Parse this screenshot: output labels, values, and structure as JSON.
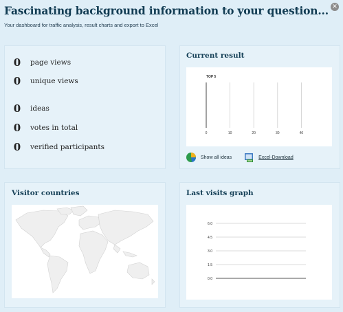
{
  "header": {
    "title": "Fascinating background information to your question...",
    "subtitle": "Your dashboard for traffic analysis, result charts and export to Excel",
    "close_icon": "close-icon"
  },
  "stats": {
    "items": [
      {
        "value": "0",
        "label": "page views"
      },
      {
        "value": "0",
        "label": "unique views"
      },
      {
        "value": "0",
        "label": "ideas"
      },
      {
        "value": "0",
        "label": "votes in total"
      },
      {
        "value": "0",
        "label": "verified participants"
      }
    ]
  },
  "current_result": {
    "title": "Current result",
    "show_all_label": "Show all ideas",
    "excel_label": "Excel-Download",
    "pie_icon": "pie-chart-icon",
    "excel_icon": "excel-icon"
  },
  "countries": {
    "title": "Visitor countries"
  },
  "visits": {
    "title": "Last visits graph"
  },
  "chart_data": [
    {
      "type": "bar",
      "title": "TOP 5",
      "orientation": "horizontal",
      "categories": [],
      "values": [],
      "xlim": [
        0,
        50
      ],
      "x_ticks": [
        "0",
        "10",
        "20",
        "30",
        "40"
      ],
      "grid": true
    },
    {
      "type": "line",
      "title": "",
      "x": [],
      "y": [],
      "ylim": [
        0,
        6
      ],
      "y_ticks": [
        "6.0",
        "4.5",
        "3.0",
        "1.5",
        "0.0"
      ],
      "grid": true
    }
  ]
}
